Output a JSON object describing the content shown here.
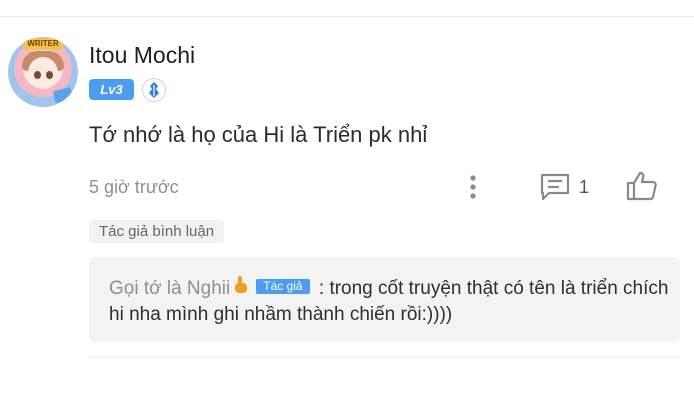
{
  "comment": {
    "username": "Itou Mochi",
    "avatar_label": "WRITER",
    "level": "Lv3",
    "text": "Tớ nhớ là họ của Hi là Triển pk nhỉ",
    "timestamp": "5 giờ trước",
    "reply_count": "1",
    "author_tag": "Tác giả bình luận"
  },
  "reply": {
    "author": "Gọi tớ là Nghii",
    "author_chip": "Tác giả",
    "separator": " : ",
    "text": "trong cốt truyện thật có tên là triển chích hi nha mình ghi nhầm thành chiến rồi:))))"
  },
  "icons": {
    "more": "more-vertical-icon",
    "reply": "comment-icon",
    "like": "thumbs-up-icon",
    "rank": "rank-shield-icon",
    "hand": "pointing-hand-icon"
  },
  "colors": {
    "accent": "#4c9cf0",
    "muted_text": "#8f8f8f",
    "reply_bg": "#f3f3f3"
  }
}
